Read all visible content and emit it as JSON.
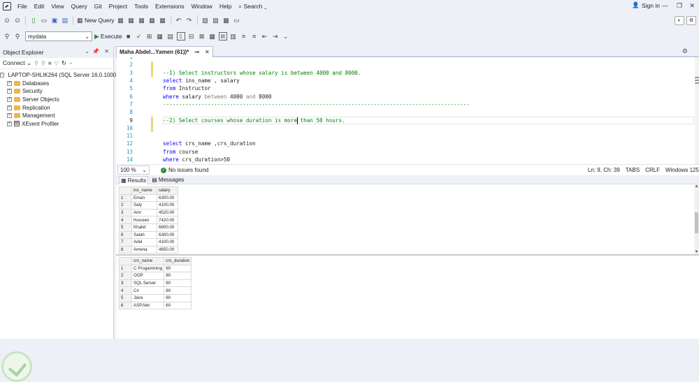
{
  "menu": {
    "items": [
      "File",
      "Edit",
      "View",
      "Query",
      "Git",
      "Project",
      "Tools",
      "Extensions",
      "Window",
      "Help"
    ],
    "search_label": "Search",
    "signin_label": "Sign in"
  },
  "toolbar": {
    "new_query_label": "New Query",
    "database": "mydata",
    "execute_label": "Execute"
  },
  "object_explorer": {
    "title": "Object Explorer",
    "connect_label": "Connect",
    "server": "LAPTOP-SHLIK264 (SQL Server 16.0.1000",
    "nodes": [
      "Databases",
      "Security",
      "Server Objects",
      "Replication",
      "Management",
      "XEvent Profiler"
    ]
  },
  "tab": {
    "title": "Maha Abdel...Yamen (61))*"
  },
  "editor": {
    "line_numbers": [
      "1",
      "2",
      "3",
      "4",
      "5",
      "6",
      "7",
      "8",
      "9",
      "10",
      "11",
      "12",
      "13",
      "14"
    ],
    "lines": [
      {
        "n": "3",
        "parts": [
          {
            "t": "--1) Select instructors whose salary is between 4000 and 8000.",
            "c": "cm"
          }
        ]
      },
      {
        "n": "4",
        "parts": [
          {
            "t": "select",
            "c": "kw"
          },
          {
            "t": " ins_name , salary",
            "c": ""
          }
        ]
      },
      {
        "n": "5",
        "parts": [
          {
            "t": "from",
            "c": "kw"
          },
          {
            "t": " Instructor",
            "c": ""
          }
        ]
      },
      {
        "n": "6",
        "parts": [
          {
            "t": "where",
            "c": "kw"
          },
          {
            "t": " salary ",
            "c": ""
          },
          {
            "t": "between",
            "c": "gr"
          },
          {
            "t": " 4000 ",
            "c": ""
          },
          {
            "t": "and",
            "c": "gr"
          },
          {
            "t": " 8000",
            "c": ""
          }
        ]
      },
      {
        "n": "7",
        "parts": [
          {
            "t": "------------------------------------------------------------------------------------------------",
            "c": "cm"
          }
        ]
      },
      {
        "n": "9",
        "parts": [
          {
            "t": "--2) Select courses whose duration is more than 50 hours.",
            "c": "cm"
          }
        ]
      },
      {
        "n": "12",
        "parts": [
          {
            "t": "select",
            "c": "kw"
          },
          {
            "t": " crs_name ,crs_duration",
            "c": ""
          }
        ]
      },
      {
        "n": "13",
        "parts": [
          {
            "t": "from",
            "c": "kw"
          },
          {
            "t": " course",
            "c": ""
          }
        ]
      },
      {
        "n": "14",
        "parts": [
          {
            "t": "where",
            "c": "kw"
          },
          {
            "t": " crs_duration>50",
            "c": ""
          }
        ]
      }
    ]
  },
  "status": {
    "zoom": "100 %",
    "issues": "No issues found",
    "position": "Ln: 9, Ch: 39",
    "tabs": "TABS",
    "eol": "CRLF",
    "encoding": "Windows 125"
  },
  "results": {
    "tab_results": "Results",
    "tab_messages": "Messages",
    "grid1": {
      "columns": [
        "ins_name",
        "salary"
      ],
      "rows": [
        [
          "1",
          "Eman",
          "6300.00"
        ],
        [
          "2",
          "Saly",
          "4100.00"
        ],
        [
          "3",
          "Amr",
          "4520.00"
        ],
        [
          "4",
          "Hussien",
          "7420.00"
        ],
        [
          "5",
          "Khalid",
          "6800.00"
        ],
        [
          "6",
          "Salah",
          "6300.00"
        ],
        [
          "7",
          "Adel",
          "4100.00"
        ],
        [
          "8",
          "Amena",
          "4650.00"
        ]
      ]
    },
    "grid2": {
      "columns": [
        "crs_name",
        "crs_duration"
      ],
      "rows": [
        [
          "1",
          "C Progamming",
          "60"
        ],
        [
          "2",
          "OOP",
          "80"
        ],
        [
          "3",
          "SQL Server",
          "60"
        ],
        [
          "4",
          "C#",
          "80"
        ],
        [
          "5",
          "Java",
          "60"
        ],
        [
          "6",
          "ASP.Net",
          "60"
        ]
      ]
    }
  },
  "colors": {
    "keyword": "#0000ff",
    "comment": "#008000",
    "operator": "#808080",
    "line_number": "#2b91af"
  }
}
